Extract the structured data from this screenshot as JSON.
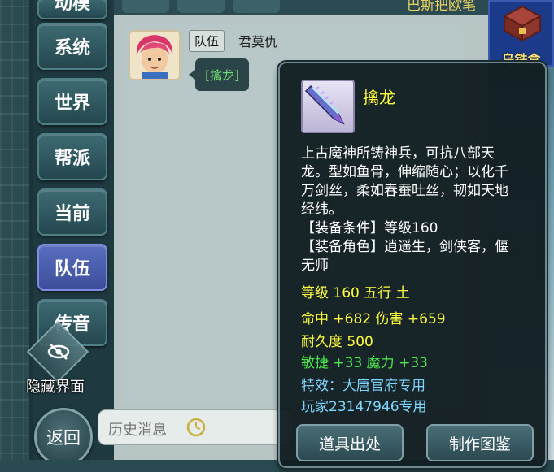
{
  "channels": {
    "top_partial": "动模",
    "items": [
      {
        "label": "系统"
      },
      {
        "label": "世界"
      },
      {
        "label": "帮派"
      },
      {
        "label": "当前"
      },
      {
        "label": "队伍"
      },
      {
        "label": "传音"
      }
    ],
    "active": "队伍"
  },
  "top_bar": {
    "partial_text": "巴斯把欧笔"
  },
  "chat": {
    "message": {
      "channel_tag": "队伍",
      "sender": "君莫仇",
      "item_link": "[擒龙]"
    }
  },
  "hide_ui": {
    "label": "隐藏界面"
  },
  "back_button": {
    "label": "返回"
  },
  "history_input": {
    "placeholder": "历史消息"
  },
  "treasure_box": {
    "label": "乌铁盒"
  },
  "tooltip": {
    "item_name": "擒龙",
    "description": "上古魔神所铸神兵，可抗八部天龙。型如鱼骨，伸缩随心；以化千万剑丝，柔如春蚕吐丝，韧如天地经纬。",
    "equip_condition": "【装备条件】等级160",
    "equip_role": "【装备角色】逍遥生，剑侠客，偃无师",
    "level_line": "等级 160  五行 土",
    "hit_damage_line": "命中 +682 伤害 +659",
    "durability_line": "耐久度 500",
    "agility_magic_line": "敏捷 +33 魔力 +33",
    "special_effect_line": "特效：大唐官府专用",
    "owner_line": "玩家23147946专用",
    "source_button": "道具出处",
    "craft_button": "制作图鉴"
  },
  "colors": {
    "item_name": "#ffff40",
    "stat_yellow": "#ffff40",
    "stat_green": "#4ee84e",
    "stat_blue": "#7fd6ff",
    "active_channel": "#4a5cb0"
  }
}
